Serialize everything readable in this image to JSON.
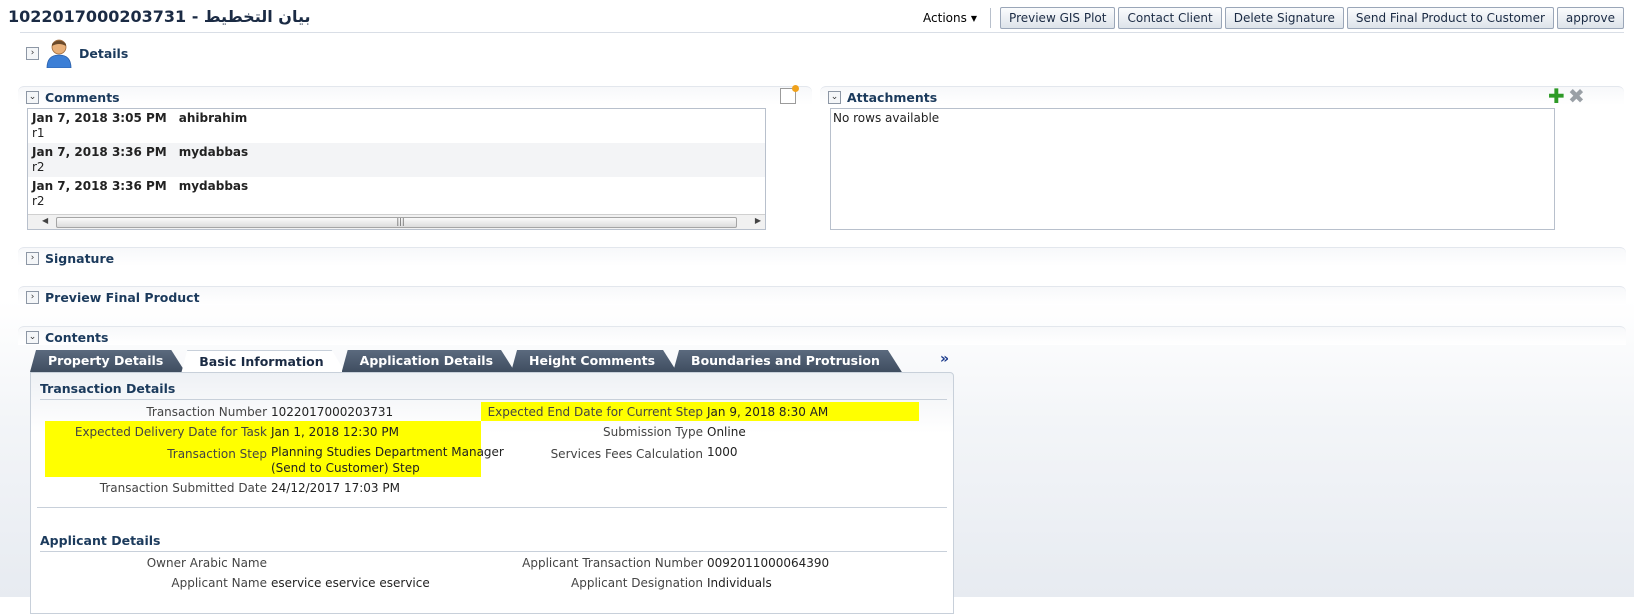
{
  "header": {
    "title": "1022017000203731 - بيان التخطيط",
    "actions_label": "Actions",
    "buttons": [
      "Preview GIS Plot",
      "Contact Client",
      "Delete Signature",
      "Send Final Product to Customer",
      "approve"
    ]
  },
  "sections": {
    "details": "Details",
    "comments": "Comments",
    "attachments": "Attachments",
    "signature": "Signature",
    "preview_final": "Preview Final Product",
    "contents": "Contents"
  },
  "comments": [
    {
      "date": "Jan 7, 2018 3:05 PM",
      "user": "ahibrahim",
      "text": "r1"
    },
    {
      "date": "Jan 7, 2018 3:36 PM",
      "user": "mydabbas",
      "text": "r2"
    },
    {
      "date": "Jan 7, 2018 3:36 PM",
      "user": "mydabbas",
      "text": "r2"
    }
  ],
  "attachments": {
    "empty_text": "No rows available"
  },
  "tabs": [
    "Property Details",
    "Basic Information",
    "Application Details",
    "Height Comments",
    "Boundaries and Protrusion"
  ],
  "transaction": {
    "title": "Transaction Details",
    "number_label": "Transaction Number",
    "number_value": "1022017000203731",
    "delivery_label": "Expected Delivery Date for Task",
    "delivery_value": "Jan 1, 2018 12:30 PM",
    "step_label": "Transaction Step",
    "step_value_1": "Planning Studies Department Manager",
    "step_value_2": "(Send to Customer) Step",
    "submitted_label": "Transaction Submitted Date",
    "submitted_value": "24/12/2017 17:03 PM",
    "end_label": "Expected End Date for Current Step",
    "end_value": "Jan 9, 2018 8:30 AM",
    "submission_label": "Submission Type",
    "submission_value": "Online",
    "fees_label": "Services Fees Calculation",
    "fees_value": "1000"
  },
  "applicant": {
    "title": "Applicant Details",
    "owner_arabic_label": "Owner Arabic Name",
    "owner_arabic_value": "",
    "name_label": "Applicant Name",
    "name_value": "eservice eservice eservice",
    "tx_number_label": "Applicant Transaction Number",
    "tx_number_value": "0092011000064390",
    "designation_label": "Applicant Designation",
    "designation_value": "Individuals"
  },
  "colors": {
    "highlight": "#ffff00",
    "accent": "#1b3a5c",
    "tab": "#4b5a6e"
  }
}
